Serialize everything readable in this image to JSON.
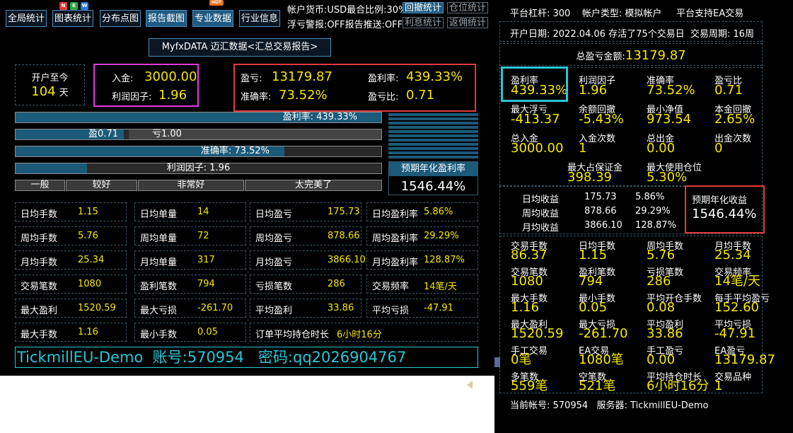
{
  "toolbar": {
    "buttons": [
      "全局统计",
      "图表统计",
      "分布点图",
      "报告截图",
      "专业数据",
      "行业信息"
    ],
    "status_line1": "帐户货币:USD最合比例:30%",
    "status_line2": "浮亏警报:OFF报告推送:OFF",
    "mini_buttons": [
      "回撤统计",
      "仓位统计",
      "利息统计",
      "返佣统计"
    ]
  },
  "header": {
    "title": "MyfxDATA 迈汇数据<汇总交易报告>"
  },
  "summary": {
    "open_label": "开户至今",
    "open_days": "104",
    "days_unit": "天",
    "deposit_label": "入金:",
    "deposit_value": "3000.00",
    "profit_factor_label": "利润因子:",
    "profit_factor_value": "1.96",
    "profit_label": "盈亏:",
    "profit_value": "13179.87",
    "profit_rate_label": "盈利率:",
    "profit_rate_value": "439.33%",
    "accuracy_label": "准确率:",
    "accuracy_value": "73.52%",
    "pl_ratio_label": "盈亏比:",
    "pl_ratio_value": "0.71"
  },
  "bars": {
    "profit_rate": {
      "label": "盈利率: 439.33%",
      "fill": 1.0
    },
    "win_loss": {
      "win_label": "盈0.71",
      "loss_label": "亏1.00",
      "win_fill": 0.295
    },
    "accuracy": {
      "label": "准确率: 73.52%",
      "fill": 0.7352
    },
    "profit_factor": {
      "label": "利润因子: 1.96",
      "fill": 0.196
    },
    "levels": [
      "一般",
      "较好",
      "非常好",
      "太完美了"
    ]
  },
  "annual": {
    "label": "预期年化盈利率",
    "value": "1546.44%"
  },
  "stats": [
    [
      "日均手数",
      "1.15",
      "日均单量",
      "14",
      "日均盈亏",
      "175.73",
      "日均盈利率",
      "5.86%"
    ],
    [
      "周均手数",
      "5.76",
      "周均单量",
      "72",
      "周均盈亏",
      "878.66",
      "周均盈利率",
      "29.29%"
    ],
    [
      "月均手数",
      "25.34",
      "月均单量",
      "317",
      "月均盈亏",
      "3866.10",
      "月均盈利率",
      "128.87%"
    ],
    [
      "交易笔数",
      "1080",
      "盈利笔数",
      "794",
      "亏损笔数",
      "286",
      "交易频率",
      "14笔/天"
    ],
    [
      "最大盈利",
      "1520.59",
      "最大亏损",
      "-261.70",
      "平均盈利",
      "33.86",
      "平均亏损",
      "-47.91"
    ]
  ],
  "last_row": {
    "k1": "最大手数",
    "v1": "1.16",
    "k2": "最小手数",
    "v2": "0.05",
    "k3": "订单平均持仓时长",
    "v3": "6小时16分"
  },
  "footer": {
    "account_line": "TickmillEU-Demo  账号:570954   密码:qq2026904767"
  },
  "right": {
    "leverage_line": "平台杠杆: 300    帐户类型: 模拟帐户     平台支持EA交易",
    "date_line": "开户日期: 2022.04.06 存活了75个交易日  交易周期: 16周",
    "total_label": "总盈亏金额:",
    "total_value": "13179.87",
    "grid1": [
      [
        "盈利率",
        "439.33%"
      ],
      [
        "利润因子",
        "1.96"
      ],
      [
        "准确率",
        "73.52%"
      ],
      [
        "盈亏比",
        "0.71"
      ],
      [
        "最大浮亏",
        "-413.37"
      ],
      [
        "余额回撤",
        "-5.43%"
      ],
      [
        "最小净值",
        "973.54"
      ],
      [
        "本金回撤",
        "2.65%"
      ],
      [
        "总入金",
        "3000.00"
      ],
      [
        "入金次数",
        "1"
      ],
      [
        "总出金",
        "0.00"
      ],
      [
        "出金次数",
        "0"
      ],
      [
        "最大占保证金",
        "398.39"
      ],
      [
        "最大使用仓位",
        "5.30%"
      ]
    ],
    "avg_rows": [
      [
        "日均收益",
        "175.73",
        "5.86%"
      ],
      [
        "周均收益",
        "878.66",
        "29.29%"
      ],
      [
        "月均收益",
        "3866.10",
        "128.87%"
      ]
    ],
    "annual_label": "预期年化收益",
    "annual_value": "1546.44%",
    "grid2": [
      [
        "交易手数",
        "86.37"
      ],
      [
        "日均手数",
        "1.15"
      ],
      [
        "周均手数",
        "5.76"
      ],
      [
        "月均手数",
        "25.34"
      ],
      [
        "交易笔数",
        "1080"
      ],
      [
        "盈利笔数",
        "794"
      ],
      [
        "亏损笔数",
        "286"
      ],
      [
        "交易频率",
        "14笔/天"
      ],
      [
        "最大手数",
        "1.16"
      ],
      [
        "最小手数",
        "0.05"
      ],
      [
        "平均开仓手数",
        "0.08"
      ],
      [
        "每手平均盈亏",
        "152.60"
      ],
      [
        "最大盈利",
        "1520.59"
      ],
      [
        "最大亏损",
        "-261.70"
      ],
      [
        "平均盈利",
        "33.86"
      ],
      [
        "平均亏损",
        "-47.91"
      ],
      [
        "手工交易",
        "0笔"
      ],
      [
        "EA交易",
        "1080笔"
      ],
      [
        "手工盈亏",
        "0.00"
      ],
      [
        "EA盈亏",
        "13179.87"
      ],
      [
        "多笔数",
        "559笔"
      ],
      [
        "空笔数",
        "521笔"
      ],
      [
        "平均持仓时长",
        "6小时16分"
      ],
      [
        "交易品种",
        "1"
      ]
    ],
    "account_line": "当前帐号: 570954   服务器: TickmillEU-Demo"
  },
  "colors": {
    "accent_value": "#f5e800",
    "highlight_magenta": "#e23ad9",
    "highlight_red": "#e23a3a",
    "highlight_cyan": "#29c6d6",
    "bar_fill": "#1c5a7a"
  }
}
